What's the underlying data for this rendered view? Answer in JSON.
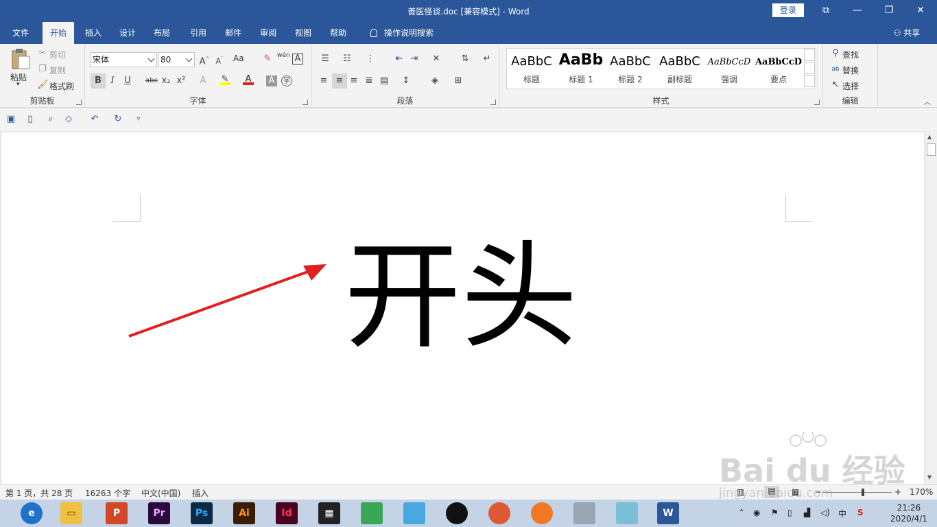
{
  "titlebar": {
    "title": "善医怪谈.doc [兼容模式]  -  Word",
    "login": "登录",
    "min": "—",
    "restore": "❐",
    "close": "✕",
    "ribbon_display": "⧉"
  },
  "tabs": [
    "文件",
    "开始",
    "插入",
    "设计",
    "布局",
    "引用",
    "邮件",
    "审阅",
    "视图",
    "帮助",
    "操作说明搜索"
  ],
  "share": "共享",
  "clipboard": {
    "paste": "粘贴",
    "cut": "剪切",
    "copy": "复制",
    "format_painter": "格式刷",
    "label": "剪贴板"
  },
  "font": {
    "name": "宋体",
    "size": "80",
    "label": "字体",
    "wen": "wén",
    "aa": "Aa",
    "bold": "B",
    "italic": "I",
    "underline": "U",
    "strike": "abc",
    "sub": "x₂",
    "sup": "x²",
    "font_color_letter": "A"
  },
  "paragraph": {
    "label": "段落"
  },
  "styles": {
    "label": "样式",
    "items": [
      {
        "sample": "AaBbC",
        "name": "标题"
      },
      {
        "sample": "AaBb",
        "name": "标题 1"
      },
      {
        "sample": "AaBbC",
        "name": "标题 2"
      },
      {
        "sample": "AaBbC",
        "name": "副标题"
      },
      {
        "sample": "AaBbCcD",
        "name": "强调"
      },
      {
        "sample": "AaBbCcD",
        "name": "要点"
      }
    ]
  },
  "editing": {
    "find": "查找",
    "replace": "替换",
    "select": "选择",
    "label": "编辑"
  },
  "document": {
    "text": "开头"
  },
  "statusbar": {
    "page": "第 1 页，共 28 页",
    "words": "16263 个字",
    "lang": "中文(中国)",
    "mode": "插入",
    "zoom": "170%",
    "zoom_minus": "−",
    "zoom_plus": "+"
  },
  "taskbar": {
    "apps": [
      {
        "label": "P",
        "color": "#d24726"
      },
      {
        "label": "Pr",
        "color": "#2a0a3d"
      },
      {
        "label": "Ps",
        "color": "#0b2a45"
      },
      {
        "label": "Ai",
        "color": "#3b1d05"
      },
      {
        "label": "Id",
        "color": "#49021f"
      },
      {
        "label": "▦",
        "color": "#222222"
      },
      {
        "label": "",
        "color": "#3aa757"
      },
      {
        "label": "",
        "color": "#4aa8e0"
      },
      {
        "label": "",
        "color": "#111111"
      },
      {
        "label": "",
        "color": "#de5833"
      },
      {
        "label": "",
        "color": "#f07a24"
      },
      {
        "label": "",
        "color": "#9aa6b3"
      },
      {
        "label": "",
        "color": "#7bbfd6"
      },
      {
        "label": "W",
        "color": "#2b579a"
      }
    ],
    "ime": "中",
    "time": "21:26",
    "date": "2020/4/1"
  },
  "watermark": {
    "text": "Bai du 经验",
    "url": "jingyan.baidu.com"
  }
}
